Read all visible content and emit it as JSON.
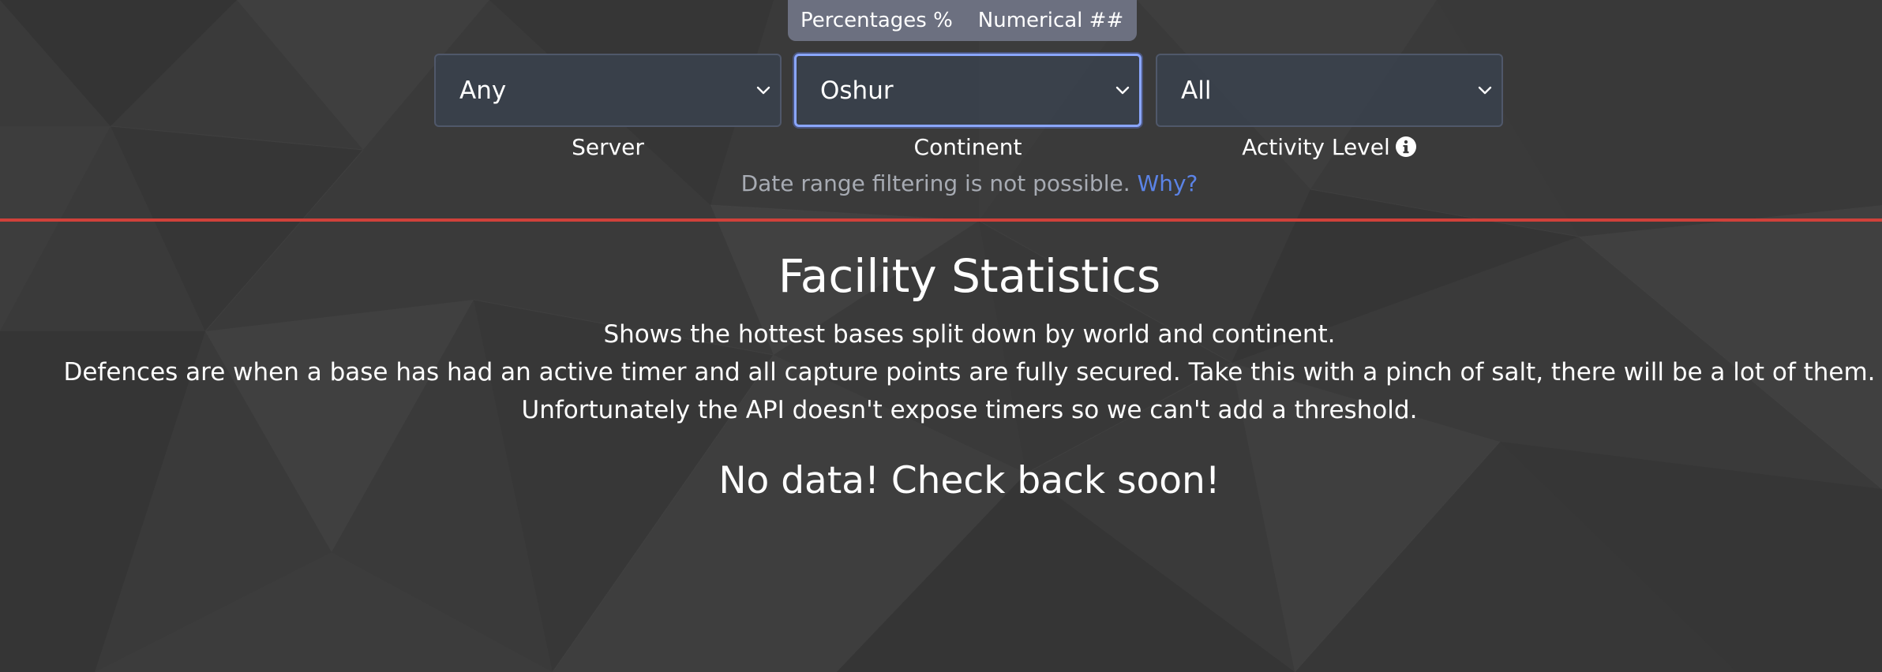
{
  "mode_toggle": {
    "percentages_label": "Percentages %",
    "numerical_label": "Numerical ##"
  },
  "filters": {
    "server": {
      "value": "Any",
      "label": "Server"
    },
    "continent": {
      "value": "Oshur",
      "label": "Continent"
    },
    "activity": {
      "value": "All",
      "label": "Activity Level"
    }
  },
  "date_note": {
    "text": "Date range filtering is not possible.",
    "link": "Why?"
  },
  "main": {
    "title": "Facility Statistics",
    "description": [
      "Shows the hottest bases split down by world and continent.",
      "Defences are when a base has had an active timer and all capture points are fully secured. Take this with a pinch of salt, there will be a lot of them.",
      "Unfortunately the API doesn't expose timers so we can't add a threshold."
    ],
    "empty_message": "No data! Check back soon!"
  },
  "colors": {
    "divider": "#d0413a",
    "link": "#5b83e6",
    "toggle_bg": "#6c7080"
  },
  "icons": {
    "select_arrow": "chevron-down-icon",
    "activity_info": "info-icon"
  }
}
